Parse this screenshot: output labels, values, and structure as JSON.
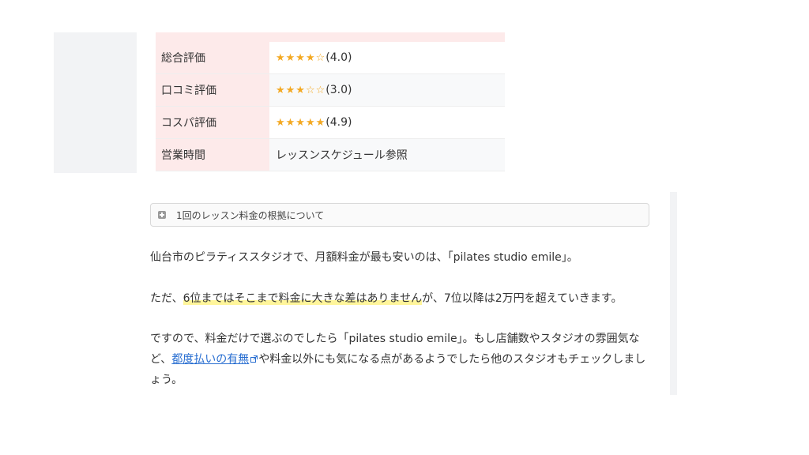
{
  "rating_table": {
    "rows": [
      {
        "label": "総合評価",
        "stars": "★★★★☆",
        "score": "(4.0)"
      },
      {
        "label": "口コミ評価",
        "stars": "★★★☆☆",
        "score": "(3.0)"
      },
      {
        "label": "コスパ評価",
        "stars": "★★★★★",
        "score": "(4.9)"
      },
      {
        "label": "営業時間",
        "text": "レッスンスケジュール参照"
      }
    ]
  },
  "accordion": {
    "label": "1回のレッスン料金の根拠について",
    "icon": "plus-square-icon"
  },
  "paragraphs": {
    "p1": "仙台市のピラティススタジオで、月額料金が最も安いのは、「pilates studio emile」。",
    "p2_before": "ただ、",
    "p2_highlight": "6位まではそこまで料金に大きな差はありません",
    "p2_after": "が、7位以降は2万円を超えていきます。",
    "p3_before": "ですので、料金だけで選ぶのでしたら「pilates studio emile」。もし店舗数やスタジオの雰囲気など、",
    "p3_link": "都度払いの有無",
    "p3_after": "や料金以外にも気になる点があるようでしたら他のスタジオもチェックしましょう。"
  },
  "colors": {
    "star": "#f3a923",
    "table_header_bg": "#fdeaea",
    "highlight": "#fff59a",
    "link": "#2a6fd1"
  }
}
